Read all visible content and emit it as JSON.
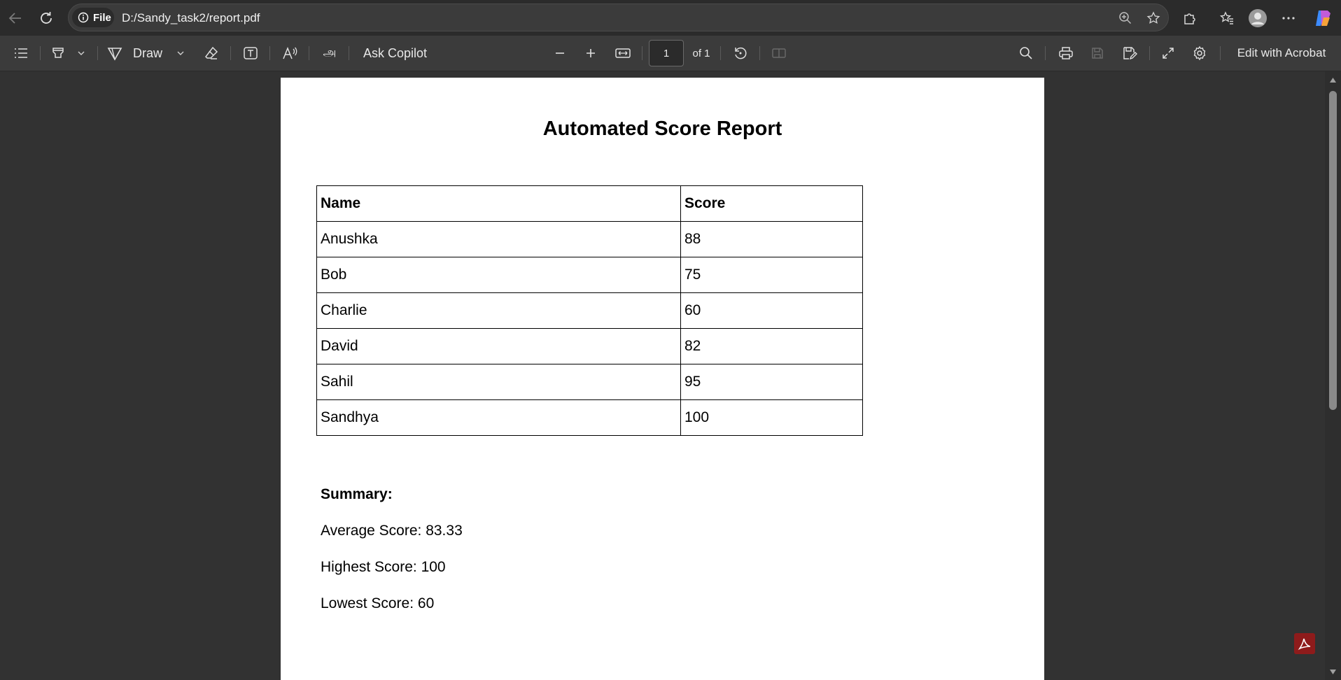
{
  "browser": {
    "file_chip": "File",
    "url": "D:/Sandy_task2/report.pdf"
  },
  "toolbar": {
    "draw_label": "Draw",
    "ask_copilot": "Ask Copilot",
    "page_number": "1",
    "page_of": "of 1",
    "edit_acrobat": "Edit with Acrobat"
  },
  "document": {
    "title": "Automated Score Report",
    "table": {
      "headers": [
        "Name",
        "Score"
      ],
      "rows": [
        [
          "Anushka",
          "88"
        ],
        [
          "Bob",
          "75"
        ],
        [
          "Charlie",
          "60"
        ],
        [
          "David",
          "82"
        ],
        [
          "Sahil",
          "95"
        ],
        [
          "Sandhya",
          "100"
        ]
      ]
    },
    "summary": {
      "heading": "Summary:",
      "average": "Average Score: 83.33",
      "highest": "Highest Score: 100",
      "lowest": "Lowest Score: 60"
    }
  },
  "colors": {
    "background": "#323232",
    "toolbar": "#3b3b3b",
    "acrobat_red": "#8e1b1b"
  }
}
